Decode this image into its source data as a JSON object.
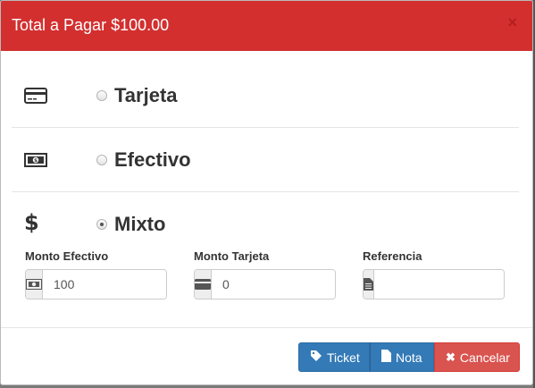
{
  "modal": {
    "title": "Total a Pagar $100.00",
    "close": "×"
  },
  "options": [
    {
      "label": "Tarjeta",
      "icon": "credit-card-icon",
      "checked": false
    },
    {
      "label": "Efectivo",
      "icon": "money-bill-icon",
      "checked": false
    },
    {
      "label": "Mixto",
      "icon": "dollar-icon",
      "checked": true,
      "icon_glyph": "$"
    }
  ],
  "fields": {
    "monto_efectivo": {
      "label": "Monto Efectivo",
      "value": "100",
      "icon": "money-bill-icon"
    },
    "monto_tarjeta": {
      "label": "Monto Tarjeta",
      "value": "0",
      "icon": "credit-card-icon"
    },
    "referencia": {
      "label": "Referencia",
      "value": "",
      "icon": "file-text-icon"
    }
  },
  "footer": {
    "ticket_label": "Ticket",
    "nota_label": "Nota",
    "cancel_label": "Cancelar"
  },
  "colors": {
    "header": "#d32f2f",
    "primary": "#337ab7",
    "danger": "#d9534f"
  }
}
